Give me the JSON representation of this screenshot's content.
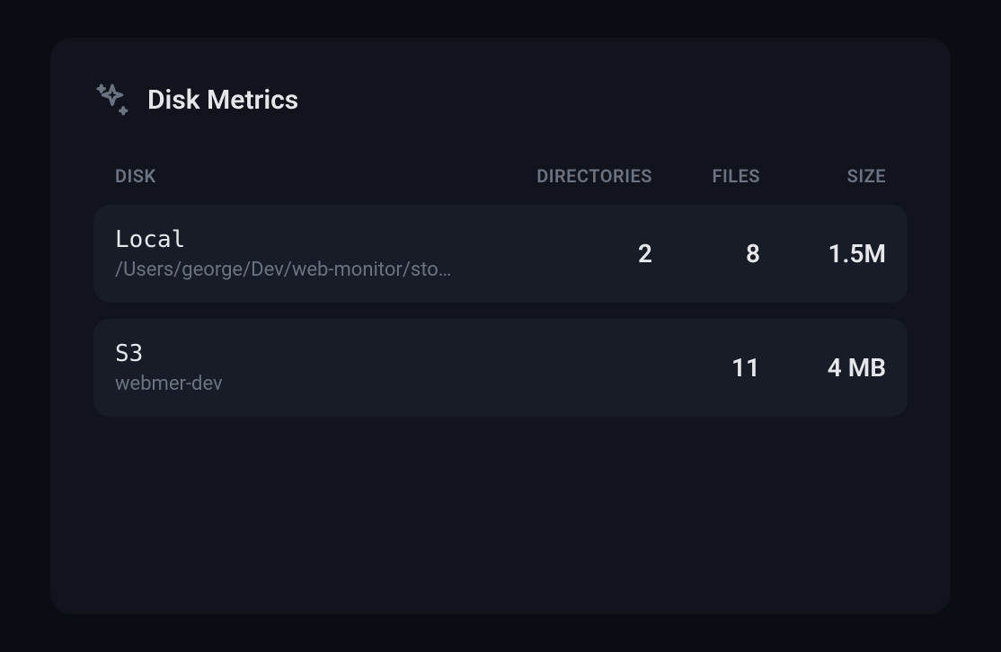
{
  "card": {
    "title": "Disk Metrics"
  },
  "table": {
    "headers": {
      "disk": "DISK",
      "directories": "DIRECTORIES",
      "files": "FILES",
      "size": "SIZE"
    },
    "rows": [
      {
        "name": "Local",
        "path": "/Users/george/Dev/web-monitor/sto…",
        "directories": "2",
        "files": "8",
        "size": "1.5M"
      },
      {
        "name": "S3",
        "path": "webmer-dev",
        "directories": "",
        "files": "11",
        "size": "4 MB"
      }
    ]
  }
}
